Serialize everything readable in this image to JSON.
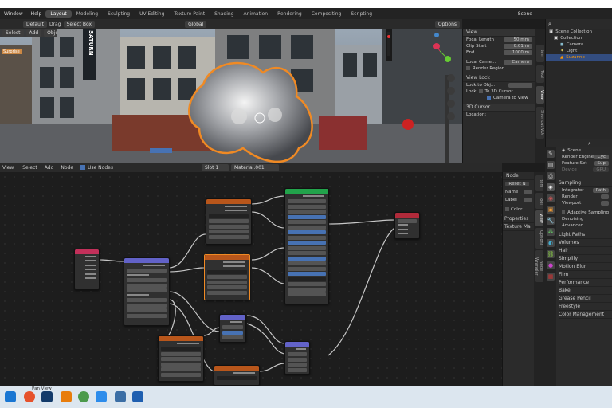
{
  "menubar": {
    "items": [
      "Window",
      "Help"
    ],
    "workspaces": [
      "Layout",
      "Modeling",
      "Sculpting",
      "UV Editing",
      "Texture Paint",
      "Shading",
      "Animation",
      "Rendering",
      "Compositing",
      "Scripting"
    ],
    "active_workspace": "Layout",
    "scene_label": "Scene"
  },
  "viewport_header": {
    "select_mode": "Default",
    "drag_label": "Drag",
    "select_box": "Select Box",
    "orientation": "Global",
    "options_label": "Options",
    "menu": [
      "Select",
      "Add",
      "Object"
    ]
  },
  "viewport": {
    "sign_text": "SATURN",
    "sticker_text": "Surprise"
  },
  "npanel": {
    "view_title": "View",
    "focal_length_label": "Focal Length",
    "focal_length_value": "50 mm",
    "clip_start_label": "Clip Start",
    "clip_start_value": "0.01 m",
    "end_label": "End",
    "end_value": "1000 m",
    "local_camera_label": "Local Came...",
    "camera_value": "Camera",
    "render_region_label": "Render Region",
    "view_lock_title": "View Lock",
    "lock_to_object_label": "Lock to Obj...",
    "lock_label": "Lock",
    "lock_to_3d_cursor": "To 3D Cursor",
    "camera_to_view": "Camera to View",
    "cursor_title": "3D Cursor",
    "location_label": "Location:"
  },
  "viewport_tabs": [
    "Item",
    "Tool",
    "View",
    "Shortcut VUr"
  ],
  "outliner": {
    "scene_collection": "Scene Collection",
    "collection": "Collection",
    "items": [
      "Camera",
      "Light",
      "Suzanne"
    ]
  },
  "properties": {
    "scene_label": "Scene",
    "render_engine_label": "Render Engine",
    "render_engine_value": "Cyc",
    "feature_set_label": "Feature Set",
    "feature_set_value": "Sup",
    "device_label": "Device",
    "device_value": "GPU",
    "sampling_title": "Sampling",
    "integrator_label": "Integrator",
    "integrator_value": "Path",
    "render_label": "Render",
    "viewport_label": "Viewport",
    "adaptive_sampling": "Adaptive Sampling",
    "denoising": "Denoising",
    "advanced": "Advanced",
    "sections": [
      "Light Paths",
      "Volumes",
      "Hair",
      "Simplify",
      "Motion Blur",
      "Film",
      "Performance",
      "Bake",
      "Grease Pencil",
      "Freestyle",
      "Color Management"
    ]
  },
  "node_header": {
    "menu": [
      "View",
      "Select",
      "Add",
      "Node"
    ],
    "use_nodes_label": "Use Nodes",
    "slot_label": "Slot 1",
    "material_label": "Material.001"
  },
  "node_sidebar": {
    "node_title": "Node",
    "reset_label": "Reset N",
    "name_label": "Name",
    "label_label": "Label",
    "color_label": "Color",
    "properties_label": "Properties",
    "texture_label": "Texture Ma"
  },
  "node_tabs": [
    "Item",
    "Tool",
    "View",
    "Options",
    "Node Wrangler"
  ],
  "status_bar": {
    "pan_view": "Pan View"
  },
  "colors": {
    "accent": "#4772b3",
    "selection_outline": "#f08a24",
    "node_texture": "#b8561b",
    "node_mapping": "#6262c8",
    "node_texcoord": "#c2305a",
    "node_shader": "#22a34b",
    "node_output": "#b02a3a"
  }
}
